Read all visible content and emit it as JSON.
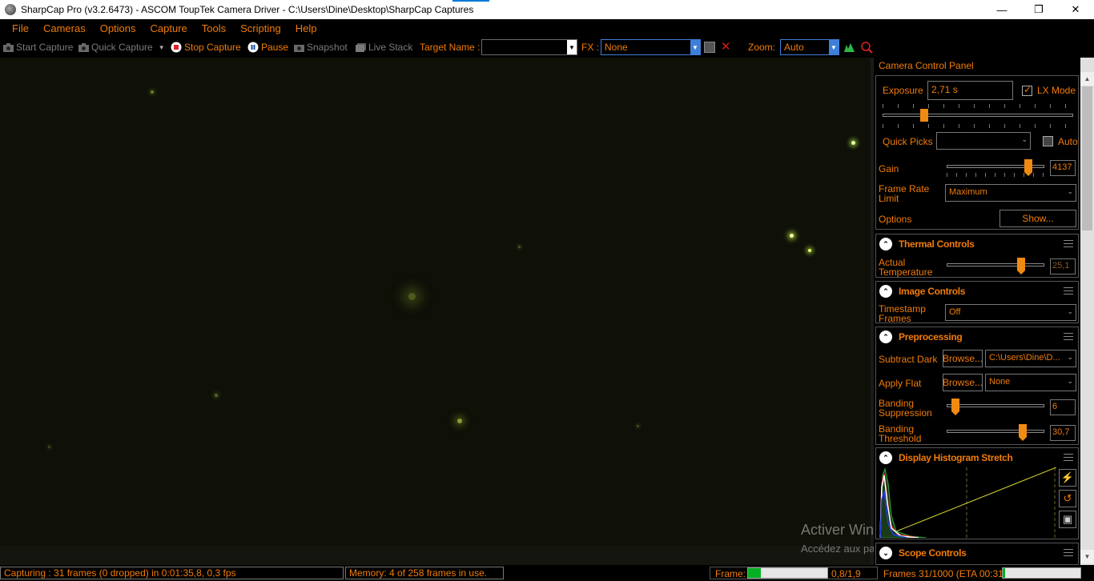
{
  "window": {
    "title": "SharpCap Pro (v3.2.6473) - ASCOM ToupTek Camera Driver - C:\\Users\\Dine\\Desktop\\SharpCap Captures",
    "minimize": "—",
    "maximize": "❐",
    "close": "✕"
  },
  "menu": [
    "File",
    "Cameras",
    "Options",
    "Capture",
    "Tools",
    "Scripting",
    "Help"
  ],
  "toolbar": {
    "start_capture": "Start Capture",
    "quick_capture": "Quick Capture",
    "stop_capture": "Stop Capture",
    "pause": "Pause",
    "snapshot": "Snapshot",
    "live_stack": "Live Stack",
    "target_name_label": "Target Name :",
    "target_name_value": "",
    "fx_label": "FX :",
    "fx_value": "None",
    "zoom_label": "Zoom:",
    "zoom_value": "Auto"
  },
  "panel": {
    "title": "Camera Control Panel",
    "camera": {
      "exposure_label": "Exposure",
      "exposure_value": "2,71 s",
      "lx_mode_label": "LX Mode",
      "lx_mode_checked": true,
      "quick_picks_label": "Quick Picks",
      "quick_picks_value": "",
      "auto_label": "Auto",
      "gain_label": "Gain",
      "gain_value": "4137",
      "gain_level": 0.83,
      "frame_rate_label_1": "Frame Rate",
      "frame_rate_label_2": "Limit",
      "frame_rate_value": "Maximum",
      "options_label": "Options",
      "show_button": "Show..."
    },
    "thermal": {
      "title": "Thermal Controls",
      "actual_temp_label_1": "Actual",
      "actual_temp_label_2": "Temperature",
      "actual_temp_value": "25,1",
      "temp_level": 0.75
    },
    "image": {
      "title": "Image Controls",
      "timestamp_label_1": "Timestamp",
      "timestamp_label_2": "Frames",
      "timestamp_value": "Off"
    },
    "preprocessing": {
      "title": "Preprocessing",
      "subtract_dark_label": "Subtract Dark",
      "subtract_dark_browse": "Browse...",
      "subtract_dark_value": "C:\\Users\\Dine\\D...",
      "apply_flat_label": "Apply Flat",
      "apply_flat_browse": "Browse...",
      "apply_flat_value": "None",
      "banding_supp_label_1": "Banding",
      "banding_supp_label_2": "Suppression",
      "banding_supp_value": "6",
      "banding_supp_level": 0.05,
      "banding_thr_label_1": "Banding",
      "banding_thr_label_2": "Threshold",
      "banding_thr_value": "30,7",
      "banding_thr_level": 0.77
    },
    "histogram": {
      "title": "Display Histogram Stretch"
    },
    "scope": {
      "title": "Scope Controls"
    }
  },
  "status": {
    "capturing": "Capturing : 31 frames (0 dropped) in 0:01:35,8, 0,3 fps",
    "memory": "Memory: 4 of 258 frames in use.",
    "frame_label": "Frame:",
    "frame_progress": 0.16,
    "frame_value": "0,8/1,9",
    "frames_count": "Frames 31/1000 (ETA 00:31)",
    "frames_progress": 0.03
  },
  "watermark": {
    "line1": "Activer Windows",
    "line2": "Accédez aux paramètres pour activer Windows."
  },
  "colors": {
    "accent": "#f07b0a",
    "background": "#000000",
    "viewer": "#0f1108",
    "progress": "#06b025"
  }
}
